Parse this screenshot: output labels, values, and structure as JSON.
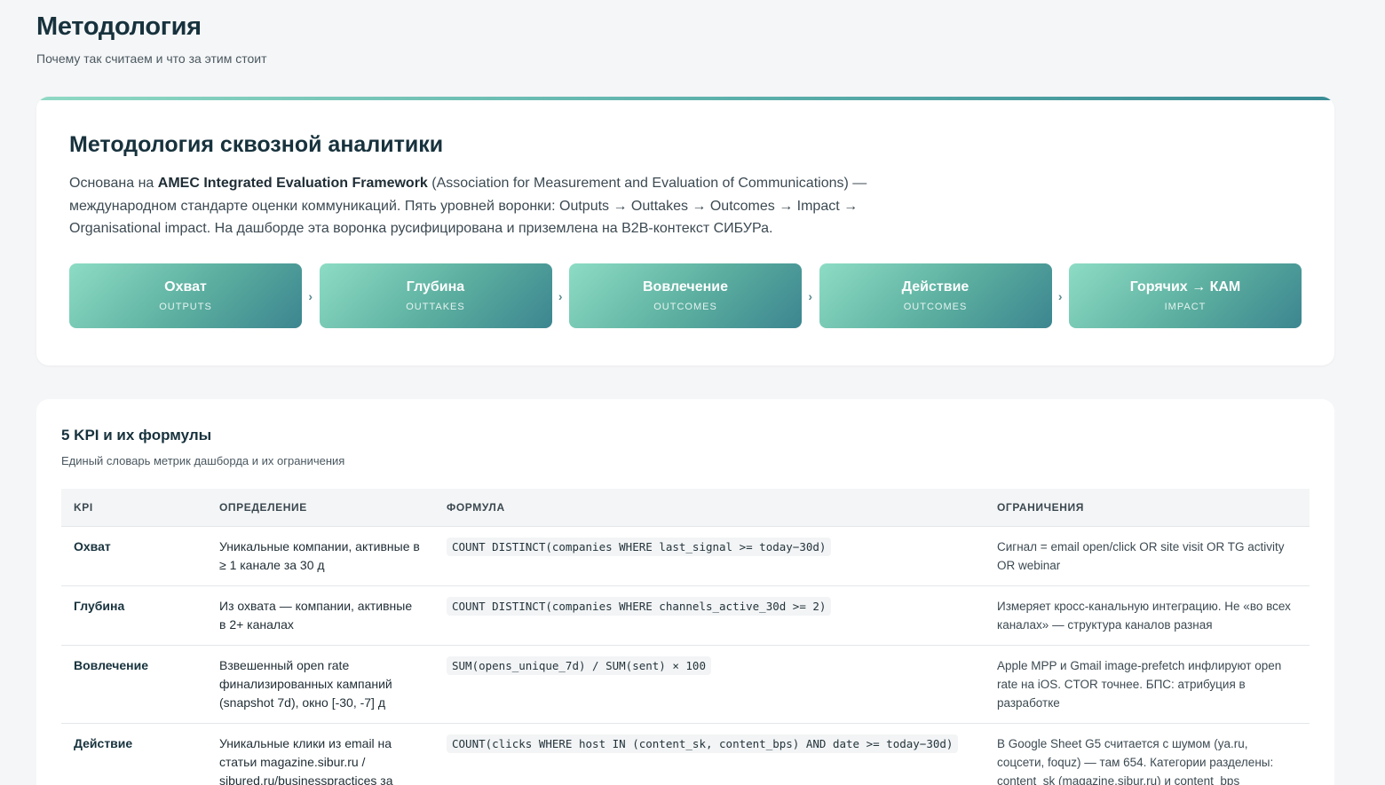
{
  "header": {
    "title": "Методология",
    "subtitle": "Почему так считаем и что за этим стоит"
  },
  "methodology": {
    "title": "Методология сквозной аналитики",
    "desc_prefix": "Основана на ",
    "desc_bold": "AMEC Integrated Evaluation Framework",
    "desc_rest": " (Association for Measurement and Evaluation of Communications) — международном стандарте оценки коммуникаций. Пять уровней воронки: Outputs → Outtakes → Outcomes → Impact → Organisational impact. На дашборде эта воронка русифицирована и приземлена на B2B-контекст СИБУРа.",
    "arrow": "›",
    "stages": [
      {
        "name": "Охват",
        "level": "OUTPUTS"
      },
      {
        "name": "Глубина",
        "level": "OUTTAKES"
      },
      {
        "name": "Вовлечение",
        "level": "OUTCOMES"
      },
      {
        "name": "Действие",
        "level": "OUTCOMES"
      },
      {
        "name": "Горячих → КАМ",
        "level": "IMPACT"
      }
    ]
  },
  "kpi": {
    "title": "5 KPI и их формулы",
    "subtitle": "Единый словарь метрик дашборда и их ограничения",
    "columns": [
      "KPI",
      "ОПРЕДЕЛЕНИЕ",
      "ФОРМУЛА",
      "ОГРАНИЧЕНИЯ"
    ],
    "rows": [
      {
        "name": "Охват",
        "definition": "Уникальные компании, активные в ≥ 1 канале за 30 д",
        "formula": "COUNT DISTINCT(companies WHERE last_signal >= today−30d)",
        "limits": "Сигнал = email open/click OR site visit OR TG activity OR webinar"
      },
      {
        "name": "Глубина",
        "definition": "Из охвата — компании, активные в 2+ каналах",
        "formula": "COUNT DISTINCT(companies WHERE channels_active_30d >= 2)",
        "limits": "Измеряет кросс-канальную интеграцию. Не «во всех каналах» — структура каналов разная"
      },
      {
        "name": "Вовлечение",
        "definition": "Взвешенный open rate финализированных кампаний (snapshot 7d), окно [-30, -7] д",
        "formula": "SUM(opens_unique_7d) / SUM(sent) × 100",
        "limits": "Apple MPP и Gmail image-prefetch инфлируют open rate на iOS. CTOR точнее. БПС: атрибуция в разработке"
      },
      {
        "name": "Действие",
        "definition": "Уникальные клики из email на статьи magazine.sibur.ru / sibured.ru/businesspractices за",
        "formula": "COUNT(clicks WHERE host IN (content_sk, content_bps) AND date >= today−30d)",
        "limits": "В Google Sheet G5 считается с шумом (ya.ru, соцсети, foquz) — там 654. Категории разделены: content_sk (magazine.sibur.ru) и content_bps"
      }
    ]
  }
}
